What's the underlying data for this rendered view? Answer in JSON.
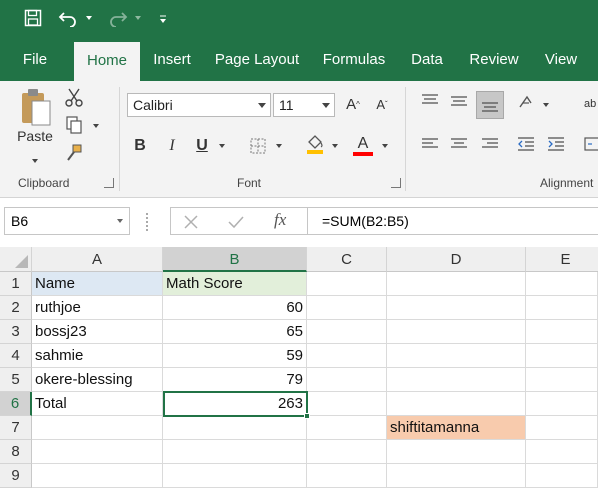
{
  "quick_access": {
    "save_icon": "floppy-disk-icon",
    "undo_icon": "undo-icon",
    "redo_icon": "redo-icon",
    "customize_icon": "customize-qat-icon"
  },
  "tabs": [
    {
      "label": "File"
    },
    {
      "label": "Home"
    },
    {
      "label": "Insert"
    },
    {
      "label": "Page Layout"
    },
    {
      "label": "Formulas"
    },
    {
      "label": "Data"
    },
    {
      "label": "Review"
    },
    {
      "label": "View"
    }
  ],
  "ribbon": {
    "clipboard": {
      "label": "Clipboard",
      "paste_label": "Paste"
    },
    "font": {
      "label": "Font",
      "font_name": "Calibri",
      "font_size": "11",
      "bold": "B",
      "italic": "I",
      "underline": "U",
      "grow": "A",
      "shrink": "A",
      "font_color_letter": "A",
      "font_color": "#ff0000",
      "fill_color": "#ffc000"
    },
    "alignment": {
      "label": "Alignment",
      "wrap_text_partial": "ab"
    }
  },
  "formula_bar": {
    "name_box": "B6",
    "fx_label": "fx",
    "formula": "=SUM(B2:B5)"
  },
  "sheet": {
    "columns": [
      "A",
      "B",
      "C",
      "D",
      "E"
    ],
    "rows": [
      "1",
      "2",
      "3",
      "4",
      "5",
      "6",
      "7",
      "8",
      "9"
    ],
    "selected_cell": "B6",
    "cells": {
      "A1": "Name",
      "B1": "Math Score",
      "A2": "ruthjoe",
      "B2": "60",
      "A3": "bossj23",
      "B3": "65",
      "A4": "sahmie",
      "B4": "59",
      "A5": "okere-blessing",
      "B5": "79",
      "A6": "Total",
      "B6": "263",
      "D7": "shiftitamanna"
    },
    "fills": {
      "A1": "#dde8f3",
      "B1": "#e2efda",
      "D7": "#f8cbad"
    }
  },
  "colors": {
    "accent": "#217346"
  }
}
